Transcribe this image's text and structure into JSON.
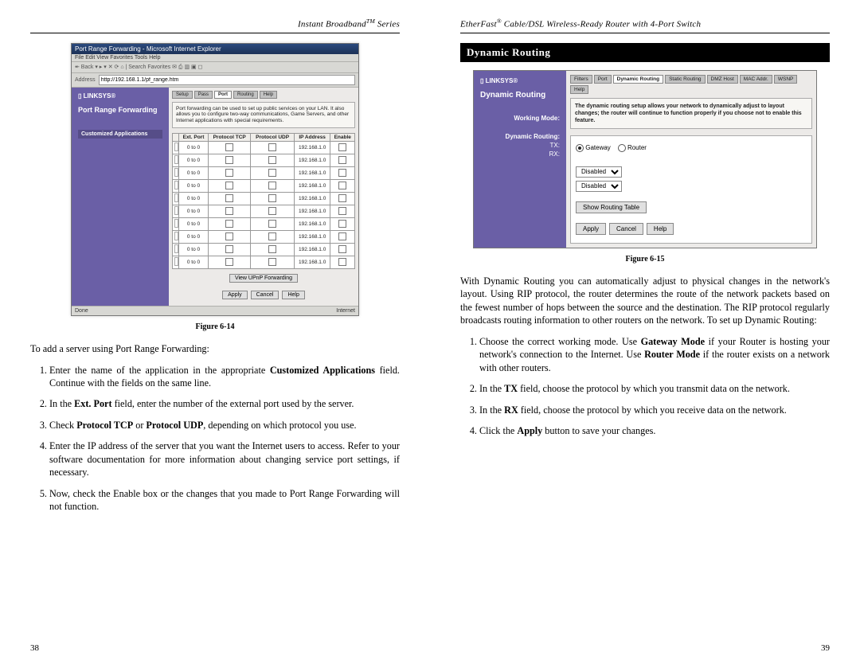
{
  "left_page": {
    "heading_html": "Instant Broadband<sup>TM</sup> Series",
    "page_number": "38",
    "figure_caption": "Figure 6-14",
    "intro": "To add a server using Port Range Forwarding:",
    "steps": [
      {
        "prefix": "Enter the name of the application in the appropriate ",
        "bold1": "Customized Applications",
        "mid": " field. Continue with the fields on the same line."
      },
      {
        "prefix": "In the ",
        "bold1": "Ext. Port",
        "mid": " field, enter the number of the external port used by the server."
      },
      {
        "prefix": "Check ",
        "bold1": "Protocol TCP",
        "mid": " or ",
        "bold2": "Protocol UDP",
        "suffix": ", depending on which protocol you use."
      },
      {
        "prefix": "Enter the IP address of the server that you want the Internet users to access. Refer to your software documentation for more information about changing service port settings, if necessary."
      },
      {
        "prefix": "Now, check the Enable box or the changes that you made to Port Range Forwarding will not function."
      }
    ],
    "fig14": {
      "title": "Port Range Forwarding - Microsoft Internet Explorer",
      "menu": "File  Edit  View  Favorites  Tools  Help",
      "toolbar": "↞ Back ▾ ▸ ▾  ✕  ⟳  ⌂  | Search  Favorites  ✉  ⎙  ▥ ▣ ◻",
      "address_label": "Address",
      "address_value": "http://192.168.1.1/pf_range.htm",
      "brand": "▯ LINKSYS®",
      "left_title": "Port Range Forwarding",
      "left_stripe": "Customized Applications",
      "tabs": [
        "Setup",
        "Pass",
        "Port",
        "Routing",
        "Help"
      ],
      "active_tab_index": 2,
      "desc": "Port forwarding can be used to set up public services on your LAN. It also allows you to configure two-way communications, Game Servers, and other Internet applications with special requirements.",
      "columns": [
        "Ext. Port",
        "Protocol TCP",
        "Protocol UDP",
        "IP Address",
        "Enable"
      ],
      "ip_value": "192.168.1.0",
      "port_to_label": "to",
      "port_value": "0",
      "row_count": 10,
      "view_btn": "View UPnP Forwarding",
      "buttons": [
        "Apply",
        "Cancel",
        "Help"
      ],
      "status_left": "Done",
      "status_right": "Internet"
    }
  },
  "right_page": {
    "heading_html": "EtherFast<sup>®</sup> Cable/DSL Wireless-Ready Router with 4-Port Switch",
    "page_number": "39",
    "section_title": "Dynamic Routing",
    "figure_caption": "Figure 6-15",
    "body1": "With Dynamic Routing you can automatically adjust to physical changes in the network's layout. Using RIP protocol, the router determines the route of the network packets based on the fewest number of hops between the source and the destination. The RIP protocol regularly broadcasts routing information to other routers on the network. To set up Dynamic Routing:",
    "steps": [
      {
        "prefix": "Choose the correct working mode. Use ",
        "bold1": "Gateway Mode",
        "mid": " if your Router is hosting your network's connection to the Internet. Use ",
        "bold2": "Router Mode",
        "suffix": " if the router exists on a network with other routers."
      },
      {
        "prefix": "In the ",
        "bold1": "TX",
        "mid": " field, choose the protocol by which you transmit data on the network."
      },
      {
        "prefix": "In the ",
        "bold1": "RX",
        "mid": " field, choose the protocol by which you receive data on the network."
      },
      {
        "prefix": "Click the ",
        "bold1": "Apply",
        "mid": " button to save your changes."
      }
    ],
    "fig15": {
      "brand": "▯ LINKSYS®",
      "sec_title": "Dynamic Routing",
      "tabs": [
        "Filters",
        "Port",
        "Dynamic Routing",
        "Static Routing",
        "DMZ Host",
        "MAC Addr.",
        "WSNP",
        "Help"
      ],
      "active_tab_index": 2,
      "desc": "The dynamic routing setup allows your network to dynamically adjust to layout changes; the router will continue to function properly if you choose not to enable this feature.",
      "working_mode_label": "Working Mode:",
      "gateway_label": "Gateway",
      "router_label": "Router",
      "dyn_label": "Dynamic Routing:",
      "tx_label": "TX:",
      "rx_label": "RX:",
      "tx_value": "Disabled",
      "rx_value": "Disabled",
      "show_btn": "Show Routing Table",
      "buttons": [
        "Apply",
        "Cancel",
        "Help"
      ]
    }
  }
}
